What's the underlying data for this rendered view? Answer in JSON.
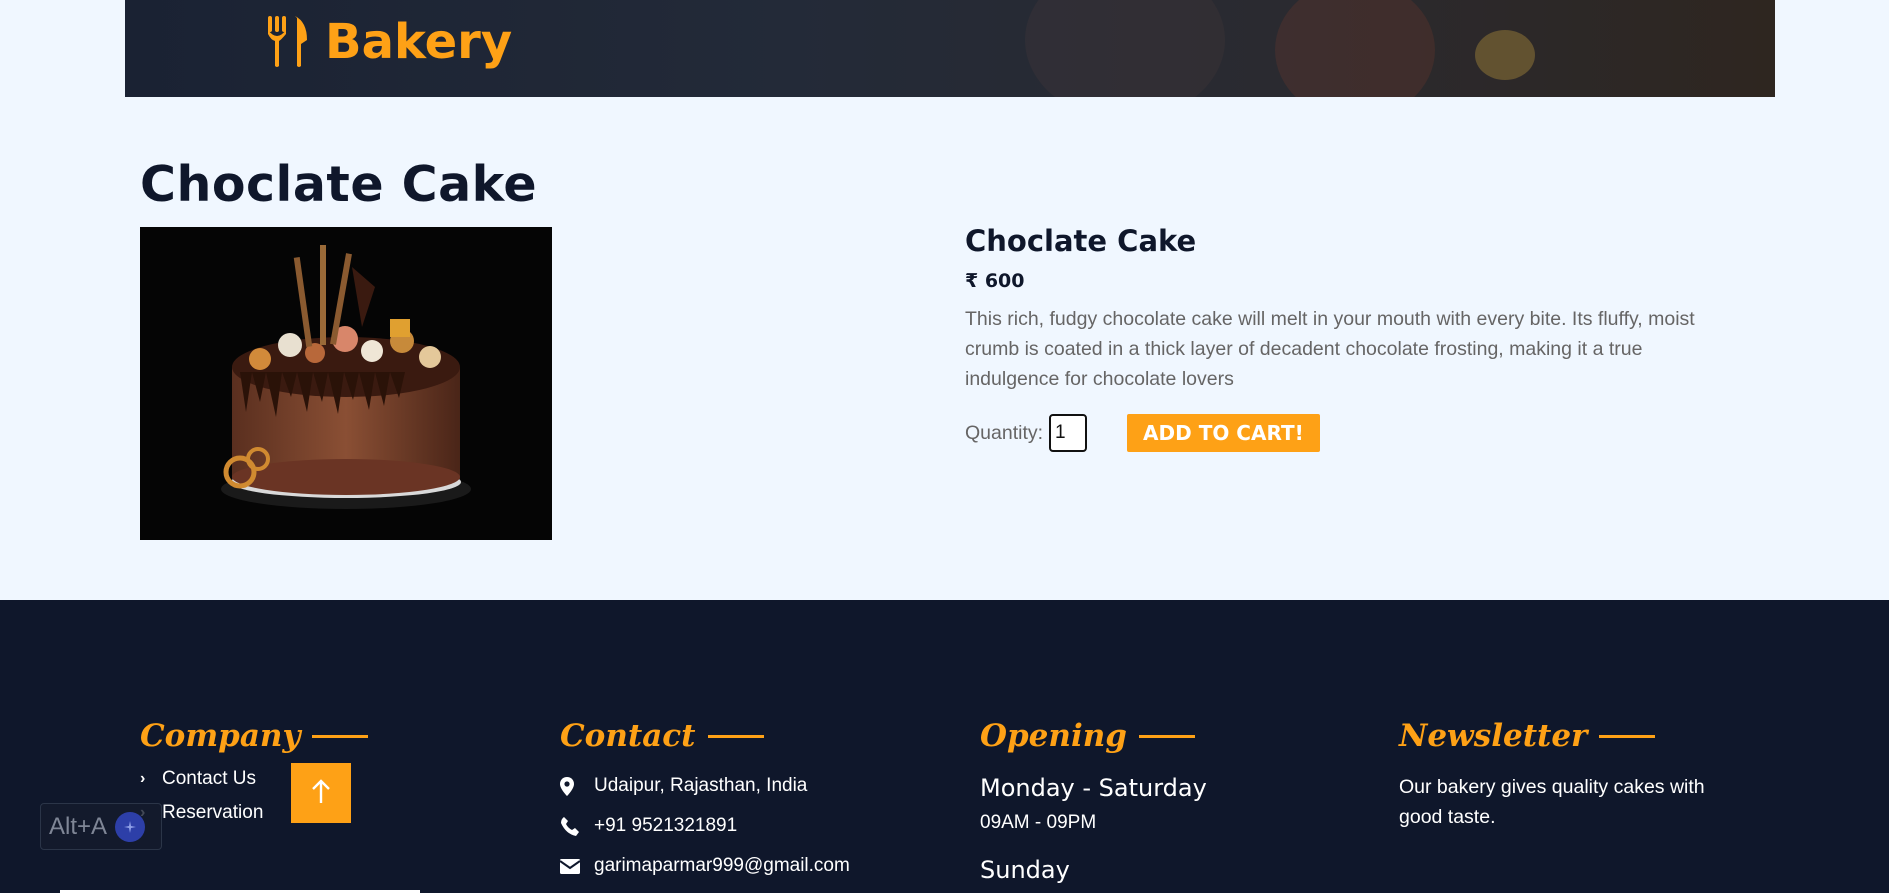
{
  "brand": {
    "name": "Bakery",
    "icon": "utensils-icon"
  },
  "page_title": "Choclate Cake",
  "product": {
    "name": "Choclate Cake",
    "price": "₹ 600",
    "description": "This rich, fudgy chocolate cake will melt in your mouth with every bite. Its fluffy, moist crumb is coated in a thick layer of decadent chocolate frosting, making it a true indulgence for chocolate lovers",
    "quantity_label": "Quantity:",
    "quantity_value": "1",
    "add_to_cart_label": "ADD TO CART!"
  },
  "footer": {
    "company": {
      "title": "Company",
      "links": [
        "Contact Us",
        "Reservation"
      ]
    },
    "contact": {
      "title": "Contact",
      "address": "Udaipur, Rajasthan, India",
      "phone": "+91 9521321891",
      "email": "garimaparmar999@gmail.com"
    },
    "opening": {
      "title": "Opening",
      "weekday_label": "Monday - Saturday",
      "weekday_hours": "09AM - 09PM",
      "weekend_label": "Sunday"
    },
    "newsletter": {
      "title": "Newsletter",
      "text": "Our bakery gives quality cakes with good taste."
    }
  },
  "overlay": {
    "shortcut_label": "Alt+A",
    "back_to_top_icon": "arrow-up-icon"
  },
  "colors": {
    "accent": "#FEA116",
    "dark": "#0f172b",
    "page_bg": "#f0f7ff",
    "text_muted": "#666565"
  }
}
